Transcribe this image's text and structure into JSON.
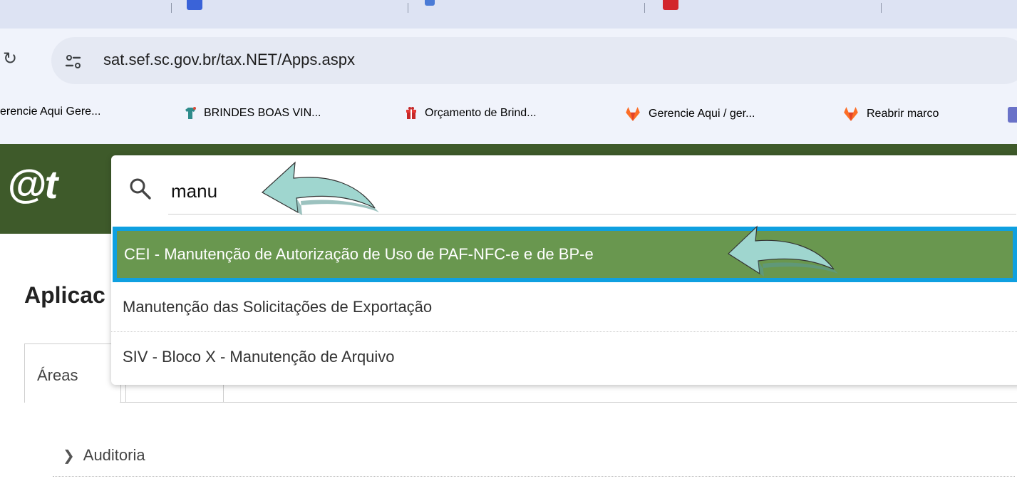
{
  "browser": {
    "url": "sat.sef.sc.gov.br/tax.NET/Apps.aspx",
    "bookmarks": [
      {
        "label": "erencie Aqui Gere...",
        "icon": "none"
      },
      {
        "label": "BRINDES BOAS VIN...",
        "icon": "tshirt-icon"
      },
      {
        "label": "Orçamento de Brind...",
        "icon": "gift-icon"
      },
      {
        "label": "Gerencie Aqui / ger...",
        "icon": "gitlab-icon"
      },
      {
        "label": "Reabrir marco",
        "icon": "gitlab-icon"
      }
    ]
  },
  "site": {
    "logo_text": "@t"
  },
  "page": {
    "title": "Aplicac",
    "tabs": [
      {
        "label": "Áreas"
      }
    ],
    "tree_items": [
      {
        "label": "Auditoria"
      }
    ]
  },
  "search": {
    "value": "manu",
    "results": [
      {
        "label": "CEI - Manutenção de Autorização de Uso de PAF-NFC-e e de BP-e",
        "selected": true
      },
      {
        "label": "Manutenção das Solicitações de Exportação",
        "selected": false
      },
      {
        "label": "SIV - Bloco X - Manutenção de Arquivo",
        "selected": false
      }
    ]
  },
  "colors": {
    "header_green": "#3e5a2a",
    "selected_row_green": "#69974f",
    "selected_row_border": "#0fa0e0",
    "annotation_arrow": "#9fd6cf"
  }
}
